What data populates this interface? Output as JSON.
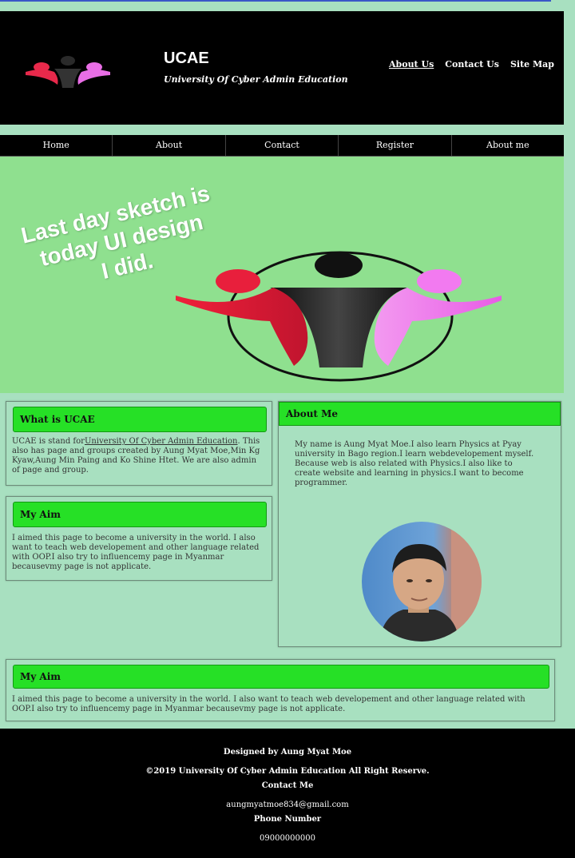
{
  "header": {
    "logo": "ucae-people-logo",
    "title": "UCAE",
    "subtitle": "University Of Cyber Admin Education",
    "links": [
      "About Us",
      "Contact Us",
      "Site Map"
    ]
  },
  "nav": {
    "items": [
      "Home",
      "About",
      "Contact",
      "Register",
      "About me"
    ]
  },
  "hero": {
    "overlay_lines": [
      "Last day sketch is",
      "today UI design",
      "I did."
    ]
  },
  "what_is": {
    "title": "What is UCAE",
    "text_before": "UCAE is stand for",
    "link": "University Of Cyber Admin Education",
    "text_after": ". This also has page and groups created by Aung Myat Moe,Min Kg Kyaw,Aung Min Paing and Ko Shine Htet. We are also admin of page and group."
  },
  "my_aim": {
    "title": "My Aim",
    "text": "I aimed this page to become a university in the world. I also want to teach web developement and other language related with OOP.I also try to influencemy page in Myanmar becausevmy page is not applicate."
  },
  "about_me": {
    "title": "About Me",
    "text": "My name is Aung Myat Moe.I also learn Physics at Pyay university in Bago region.I learn webdevelopement myself. Because web is also related with Physics.I also like to create website and learning in physics.I want to become programmer."
  },
  "my_aim_wide": {
    "title": "My Aim",
    "text": "I aimed this page to become a university in the world. I also want to teach web developement and other language related with OOP.I also try to influencemy page in Myanmar becausevmy page is not applicate."
  },
  "footer": {
    "designed_by": "Designed by Aung Myat Moe",
    "copyright": "©2019 University Of Cyber Admin Education All Right Reserve.",
    "contact_title": "Contact Me",
    "email": "aungmyatmoe834@gmail.com",
    "phone_title": "Phone Number",
    "phone": "09000000000"
  },
  "colors": {
    "page_bg": "#a8e0c0",
    "hero_bg": "#8fe08f",
    "card_header": "#26e026",
    "bar": "#000000"
  }
}
